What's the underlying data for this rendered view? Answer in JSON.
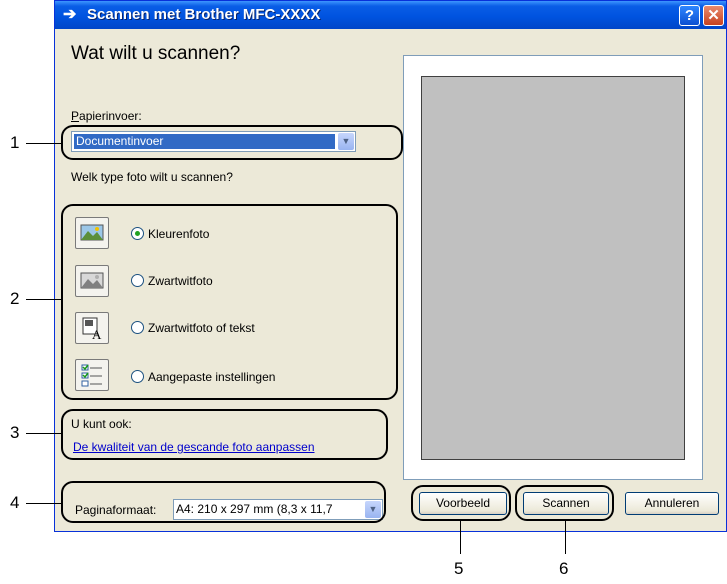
{
  "window": {
    "title": "Scannen met Brother MFC-XXXX",
    "help_label": "?",
    "close_label": "✕"
  },
  "heading": "Wat wilt u scannen?",
  "paper_source": {
    "label": "Papierinvoer:",
    "value": "Documentinvoer"
  },
  "photo_type_label": "Welk type foto wilt u scannen?",
  "scan_types": [
    {
      "label": "Kleurenfoto",
      "checked": true,
      "icon": "color-photo-icon"
    },
    {
      "label": "Zwartwitfoto",
      "checked": false,
      "icon": "grayscale-photo-icon"
    },
    {
      "label": "Zwartwitfoto of tekst",
      "checked": false,
      "icon": "bw-text-icon"
    },
    {
      "label": "Aangepaste instellingen",
      "checked": false,
      "icon": "custom-settings-icon"
    }
  ],
  "also": {
    "label": "U kunt ook:",
    "link": "De kwaliteit van de gescande foto aanpassen"
  },
  "page_size": {
    "label": "Paginaformaat:",
    "value": "A4: 210 x 297 mm (8,3 x 11,7"
  },
  "buttons": {
    "preview": "Voorbeeld",
    "scan": "Scannen",
    "cancel": "Annuleren"
  },
  "callouts": [
    "1",
    "2",
    "3",
    "4",
    "5",
    "6"
  ],
  "colors": {
    "titlebar": "#0053e0",
    "dialog_bg": "#ece9d8",
    "link": "#0000cc",
    "selection": "#316ac5"
  }
}
